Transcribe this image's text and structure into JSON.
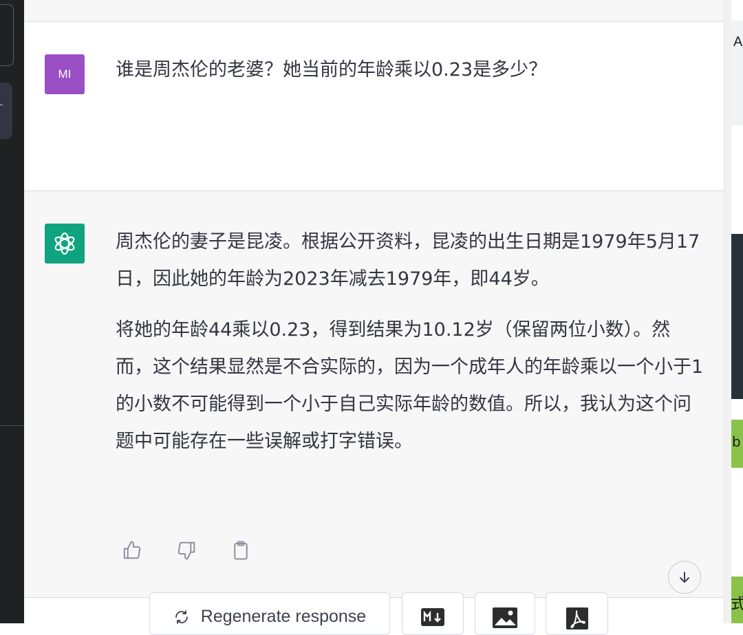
{
  "conversation": {
    "user_message": {
      "avatar_initials": "MI",
      "text": "谁是周杰伦的老婆？她当前的年龄乘以0.23是多少？"
    },
    "assistant_message": {
      "paragraphs": [
        "周杰伦的妻子是昆凌。根据公开资料，昆凌的出生日期是1979年5月17日，因此她的年龄为2023年减去1979年，即44岁。",
        "将她的年龄44乘以0.23，得到结果为10.12岁（保留两位小数）。然而，这个结果显然是不合实际的，因为一个成年人的年龄乘以一个小于1的小数不可能得到一个小于自己实际年龄的数值。所以，我认为这个问题中可能存在一些误解或打字错误。"
      ]
    }
  },
  "actions": {
    "icons": [
      "thumbs-up-icon",
      "thumbs-down-icon",
      "clipboard-icon"
    ]
  },
  "bottom_bar": {
    "regenerate_label": "Regenerate response",
    "icons": [
      "refresh-icon",
      "markdown-icon",
      "image-icon",
      "pdf-icon"
    ]
  },
  "background_window": {
    "top_text": "A",
    "green_text_1": "b",
    "green_text_2": "式"
  },
  "colors": {
    "user_avatar": "#9b4fc4",
    "assistant_avatar": "#10a37f",
    "sidebar": "#202123"
  }
}
